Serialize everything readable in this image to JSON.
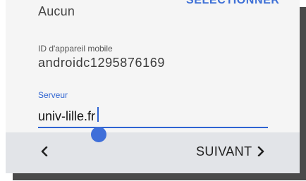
{
  "certificate": {
    "value": "Aucun",
    "select_label": "SÉLECTIONNER"
  },
  "device_id": {
    "label": "ID d'appareil mobile",
    "value": "androidc1295876169"
  },
  "server": {
    "label": "Serveur",
    "value": "univ-lille.fr"
  },
  "navigation": {
    "back_icon": "chevron-left-icon",
    "next_label": "SUIVANT",
    "next_icon": "chevron-right-icon"
  },
  "colors": {
    "accent": "#2f64d2",
    "bottom_bar": "#e2e4e8",
    "background": "#f5f5f5"
  }
}
